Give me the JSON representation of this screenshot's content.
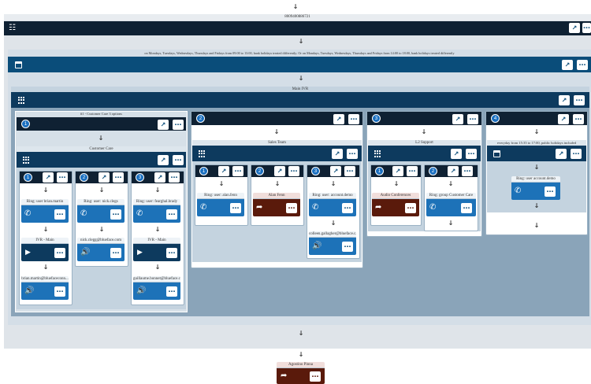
{
  "root": {
    "id": "8009400886721"
  },
  "schedule": {
    "title": "on Mondays, Tuesdays, Wednesdays, Thursdays and Fridays from 09:00 to 13:00, bank holidays treated differently; Or on Mondays, Tuesdays, Wednesdays, Thursdays and Fridays from 14:00 to 18:00, bank holidays treated differently"
  },
  "main_ivr": {
    "title": "Main IVR",
    "options": [
      {
        "number": "1",
        "title": "#1 - Customer Care 3 options",
        "sub_title": "Customer Care",
        "sub_options": [
          {
            "number": "1",
            "ring_label": "Ring: user brian.martin",
            "ivr_label": "IVR - Main",
            "voicemail_label": "brian.martin@bluefaceconn..."
          },
          {
            "number": "2",
            "ring_label": "Ring: user: nick.clegs",
            "voicemail_label": "nick.clegg@blueface.com"
          },
          {
            "number": "3",
            "ring_label": "Ring: user: fearghal.brady",
            "ivr_label": "IVR - Main",
            "voicemail_label": "guillaume.bonnet@blueface.c..."
          }
        ]
      },
      {
        "number": "2",
        "title": "Sales Team",
        "sub_options": [
          {
            "number": "1",
            "ring_label": "Ring: user: alan.fenn"
          },
          {
            "number": "2",
            "forward_label": "Alan Fenn"
          },
          {
            "number": "3",
            "ring_label": "Ring: user: account.demo",
            "voicemail_label": "colleen.gallagher@blueface.c..."
          }
        ]
      },
      {
        "number": "3",
        "title": "L2 Support",
        "sub_options": [
          {
            "number": "1",
            "forward_label": "Audio Conferences"
          },
          {
            "number": "2",
            "ring_label": "Ring: group Customer Care"
          }
        ]
      },
      {
        "number": "4",
        "schedule_title": "everyday from 15:35 to 17:00, public holidays included",
        "ring_label": "Ring: user account.demo"
      }
    ]
  },
  "final": {
    "forward_label": "Agostino Pinna"
  },
  "icons": {
    "expand": "expand-icon",
    "more": "more-icon",
    "phone": "phone-icon",
    "play": "play-icon",
    "speaker": "speaker-icon",
    "forward": "forward-icon",
    "grid": "grid-icon",
    "calendar": "calendar-icon",
    "org": "org-chart-icon"
  },
  "colors": {
    "primary": "#0a4d7a",
    "dark": "#0f2133",
    "tile_blue": "#1d72b8",
    "forward_red": "#5a1a0b",
    "panel_gray": "#c4d3df",
    "bg_blue_gray": "#8aa4b9"
  }
}
